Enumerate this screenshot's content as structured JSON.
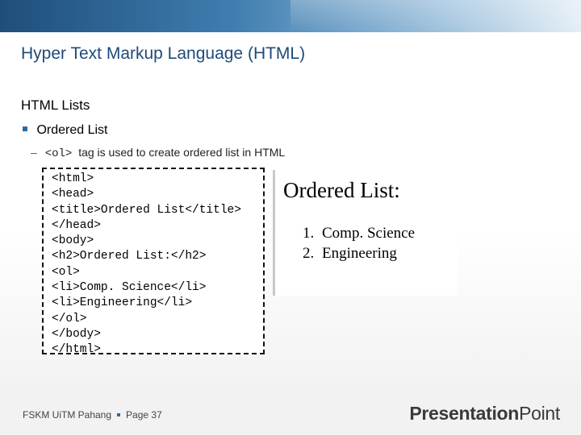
{
  "slide": {
    "title": "Hyper Text Markup Language (HTML)",
    "section": "HTML Lists",
    "bullet": "Ordered List",
    "subbullet": {
      "dash": "–",
      "code": "<ol>",
      "text": "tag is used to create ordered list in HTML"
    }
  },
  "code_lines": [
    "<html>",
    "<head>",
    "<title>Ordered List</title>",
    "</head>",
    "<body>",
    "<h2>Ordered List:</h2>",
    "<ol>",
    "<li>Comp. Science</li>",
    "<li>Engineering</li>",
    "</ol>",
    "</body>",
    "</html>"
  ],
  "rendered": {
    "heading": "Ordered List:",
    "items": [
      {
        "num": "1.",
        "label": "Comp. Science"
      },
      {
        "num": "2.",
        "label": "Engineering"
      }
    ]
  },
  "footer": {
    "org": "FSKM UiTM Pahang",
    "page": "Page 37"
  },
  "logo": {
    "part1": "Presentation",
    "part2": "Point"
  },
  "colors": {
    "title": "#1f4a7a",
    "accent": "#2f6a9e"
  }
}
